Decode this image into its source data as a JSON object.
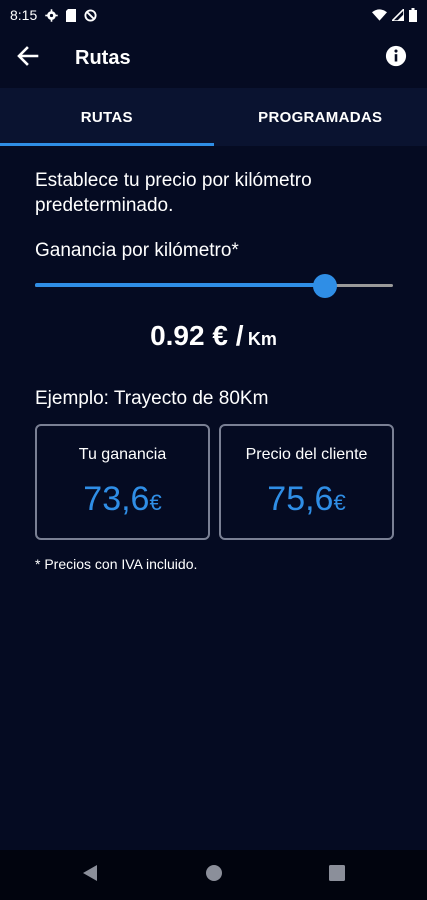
{
  "status_bar": {
    "time": "8:15",
    "icons_left": [
      "gear-icon",
      "sim-card-icon",
      "data-saver-icon"
    ],
    "icons_right": [
      "wifi-icon",
      "cell-signal-icon",
      "battery-icon"
    ]
  },
  "app_bar": {
    "title": "Rutas",
    "back_icon": "arrow-left-icon",
    "info_icon": "info-icon"
  },
  "tabs": [
    {
      "label": "RUTAS",
      "active": true
    },
    {
      "label": "PROGRAMADAS",
      "active": false
    }
  ],
  "intro_text": "Establece tu precio por kilómetro predeterminado.",
  "slider": {
    "label": "Ganancia por kilómetro*",
    "level_fraction": 0.81
  },
  "price": {
    "value": "0.92 € /",
    "unit": "Km"
  },
  "example": {
    "title": "Ejemplo: Trayecto de 80Km",
    "cards": [
      {
        "label": "Tu ganancia",
        "value": "73,6",
        "currency": "€"
      },
      {
        "label": "Precio del cliente",
        "value": "75,6",
        "currency": "€"
      }
    ]
  },
  "footnote": "* Precios con IVA incluido.",
  "colors": {
    "background": "#050b22",
    "tab_bar": "#0a1330",
    "accent": "#2f8ee6",
    "card_border": "#7a8094"
  },
  "nav_bar": {
    "icons": [
      "back-triangle-icon",
      "home-circle-icon",
      "recents-square-icon"
    ]
  }
}
